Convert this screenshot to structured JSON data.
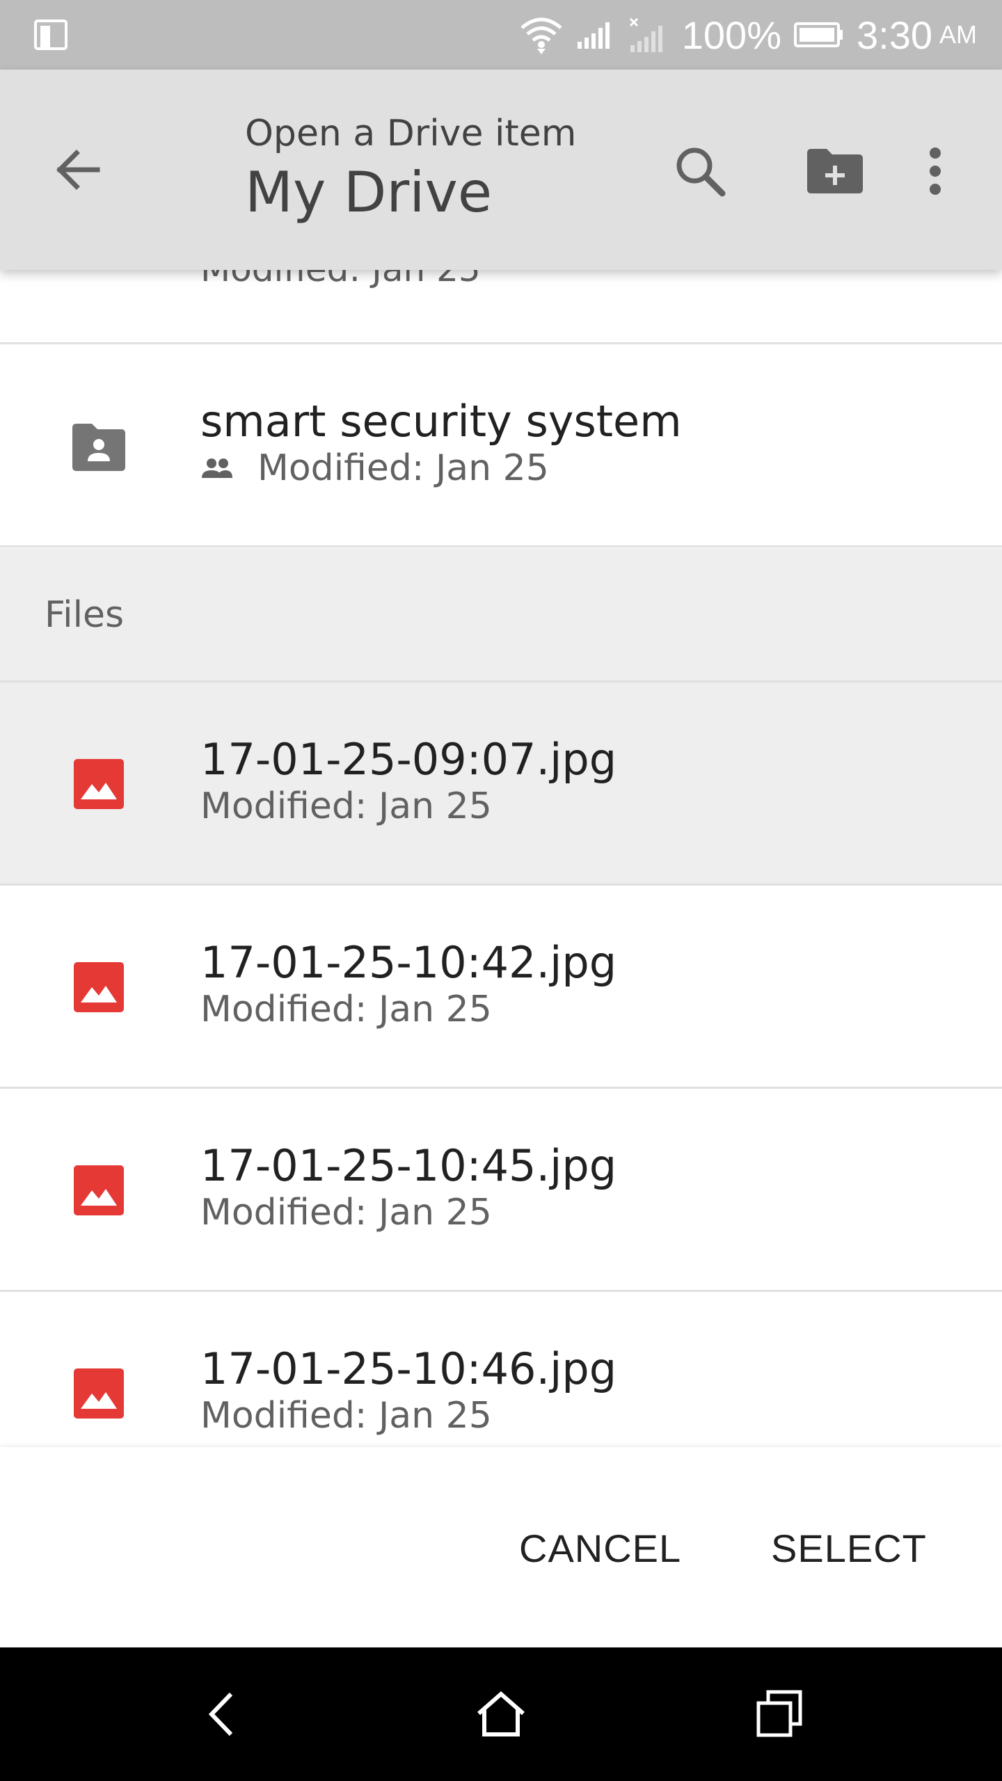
{
  "status_bar": {
    "battery": "100%",
    "time": "3:30",
    "ampm": "AM",
    "icons": [
      "screen-rotation-icon",
      "wifi-icon",
      "signal-icon",
      "signal-off-icon",
      "battery-icon"
    ]
  },
  "app_bar": {
    "subtitle": "Open a Drive item",
    "title": "My Drive",
    "actions": [
      "back-arrow-icon",
      "search-icon",
      "new-folder-icon",
      "more-vert-icon"
    ],
    "color": "#e0e0e0"
  },
  "partial_item": {
    "meta": "Modified: Jan 25"
  },
  "folders": [
    {
      "name": "smart security system",
      "meta": "Modified: Jan 25",
      "shared": true,
      "icon": "shared-folder-icon"
    }
  ],
  "files_section": {
    "header": "Files"
  },
  "files": [
    {
      "name": "17-01-25-09:07.jpg",
      "meta": "Modified: Jan 25",
      "icon": "image-file-icon",
      "selected": true
    },
    {
      "name": "17-01-25-10:42.jpg",
      "meta": "Modified: Jan 25",
      "icon": "image-file-icon",
      "selected": false
    },
    {
      "name": "17-01-25-10:45.jpg",
      "meta": "Modified: Jan 25",
      "icon": "image-file-icon",
      "selected": false
    },
    {
      "name": "17-01-25-10:46.jpg",
      "meta": "Modified: Jan 25",
      "icon": "image-file-icon",
      "selected": false
    }
  ],
  "dialog": {
    "cancel_label": "CANCEL",
    "select_label": "SELECT"
  },
  "nav_bar": {
    "buttons": [
      "nav-back-icon",
      "nav-home-icon",
      "nav-recent-apps-icon"
    ]
  },
  "colors": {
    "image_icon": "#e53935",
    "folder_icon": "#757575",
    "selected_row": "#eeeeee"
  }
}
